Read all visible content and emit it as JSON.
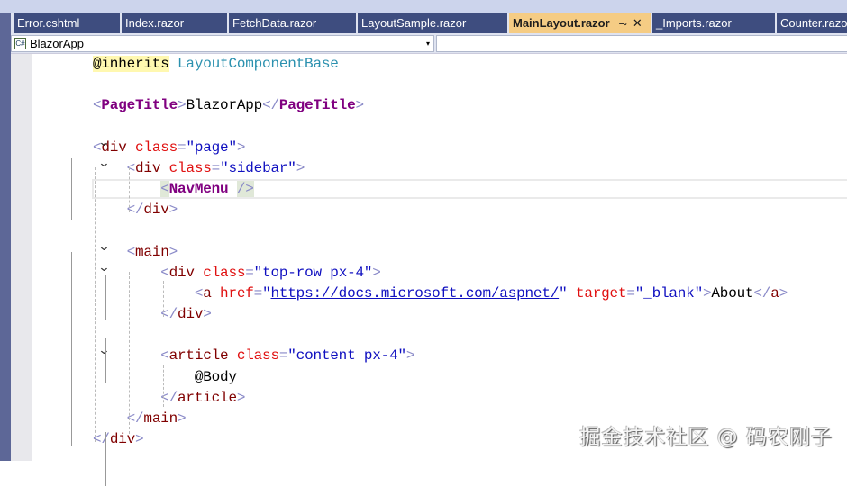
{
  "tabs": [
    {
      "label": "Error.cshtml",
      "active": false
    },
    {
      "label": "Index.razor",
      "active": false
    },
    {
      "label": "FetchData.razor",
      "active": false
    },
    {
      "label": "LayoutSample.razor",
      "active": false
    },
    {
      "label": "MainLayout.razor",
      "active": true,
      "pin": "⊸",
      "close": "✕"
    },
    {
      "label": "_Imports.razor",
      "active": false
    },
    {
      "label": "Counter.razor",
      "active": false
    }
  ],
  "navbar": {
    "project": "BlazorApp",
    "project_icon": "C#",
    "dropdown_arrow": "▾"
  },
  "editor": {
    "lines": [
      [
        {
          "t": "txt",
          "v": "@inherits",
          "c": "dir"
        },
        {
          "t": "txt",
          "v": " "
        },
        {
          "t": "type",
          "v": "LayoutComponentBase"
        }
      ],
      [],
      [
        {
          "t": "br",
          "v": "<"
        },
        {
          "t": "comp",
          "v": "PageTitle"
        },
        {
          "t": "br",
          "v": ">"
        },
        {
          "t": "txt",
          "v": "BlazorApp"
        },
        {
          "t": "br",
          "v": "</"
        },
        {
          "t": "comp",
          "v": "PageTitle"
        },
        {
          "t": "br",
          "v": ">"
        }
      ],
      [],
      [
        {
          "t": "br",
          "v": "<"
        },
        {
          "t": "el",
          "v": "div"
        },
        {
          "t": "txt",
          "v": " "
        },
        {
          "t": "at",
          "v": "class"
        },
        {
          "t": "br",
          "v": "="
        },
        {
          "t": "val",
          "v": "\"page\""
        },
        {
          "t": "br",
          "v": ">"
        }
      ],
      [
        {
          "t": "txt",
          "v": "    "
        },
        {
          "t": "br",
          "v": "<"
        },
        {
          "t": "el",
          "v": "div"
        },
        {
          "t": "txt",
          "v": " "
        },
        {
          "t": "at",
          "v": "class"
        },
        {
          "t": "br",
          "v": "="
        },
        {
          "t": "val",
          "v": "\"sidebar\""
        },
        {
          "t": "br",
          "v": ">"
        }
      ],
      [
        {
          "t": "txt",
          "v": "        "
        },
        {
          "t": "br",
          "v": "<",
          "c": "hl"
        },
        {
          "t": "comp",
          "v": "NavMenu"
        },
        {
          "t": "txt",
          "v": " "
        },
        {
          "t": "br",
          "v": "/>",
          "c": "hl"
        }
      ],
      [
        {
          "t": "txt",
          "v": "    "
        },
        {
          "t": "br",
          "v": "</"
        },
        {
          "t": "el",
          "v": "div"
        },
        {
          "t": "br",
          "v": ">"
        }
      ],
      [],
      [
        {
          "t": "txt",
          "v": "    "
        },
        {
          "t": "br",
          "v": "<"
        },
        {
          "t": "el",
          "v": "main"
        },
        {
          "t": "br",
          "v": ">"
        }
      ],
      [
        {
          "t": "txt",
          "v": "        "
        },
        {
          "t": "br",
          "v": "<"
        },
        {
          "t": "el",
          "v": "div"
        },
        {
          "t": "txt",
          "v": " "
        },
        {
          "t": "at",
          "v": "class"
        },
        {
          "t": "br",
          "v": "="
        },
        {
          "t": "val",
          "v": "\"top-row px-4\""
        },
        {
          "t": "br",
          "v": ">"
        }
      ],
      [
        {
          "t": "txt",
          "v": "            "
        },
        {
          "t": "br",
          "v": "<"
        },
        {
          "t": "el",
          "v": "a"
        },
        {
          "t": "txt",
          "v": " "
        },
        {
          "t": "at",
          "v": "href"
        },
        {
          "t": "br",
          "v": "="
        },
        {
          "t": "val",
          "v": "\""
        },
        {
          "t": "link",
          "v": "https://docs.microsoft.com/aspnet/"
        },
        {
          "t": "val",
          "v": "\""
        },
        {
          "t": "txt",
          "v": " "
        },
        {
          "t": "at",
          "v": "target"
        },
        {
          "t": "br",
          "v": "="
        },
        {
          "t": "val",
          "v": "\"_blank\""
        },
        {
          "t": "br",
          "v": ">"
        },
        {
          "t": "txt",
          "v": "About"
        },
        {
          "t": "br",
          "v": "</"
        },
        {
          "t": "el",
          "v": "a"
        },
        {
          "t": "br",
          "v": ">"
        }
      ],
      [
        {
          "t": "txt",
          "v": "        "
        },
        {
          "t": "br",
          "v": "</"
        },
        {
          "t": "el",
          "v": "div"
        },
        {
          "t": "br",
          "v": ">"
        }
      ],
      [],
      [
        {
          "t": "txt",
          "v": "        "
        },
        {
          "t": "br",
          "v": "<"
        },
        {
          "t": "el",
          "v": "article"
        },
        {
          "t": "txt",
          "v": " "
        },
        {
          "t": "at",
          "v": "class"
        },
        {
          "t": "br",
          "v": "="
        },
        {
          "t": "val",
          "v": "\"content px-4\""
        },
        {
          "t": "br",
          "v": ">"
        }
      ],
      [
        {
          "t": "txt",
          "v": "            "
        },
        {
          "t": "txt",
          "v": "@Body"
        }
      ],
      [
        {
          "t": "txt",
          "v": "        "
        },
        {
          "t": "br",
          "v": "</"
        },
        {
          "t": "el",
          "v": "article"
        },
        {
          "t": "br",
          "v": ">"
        }
      ],
      [
        {
          "t": "txt",
          "v": "    "
        },
        {
          "t": "br",
          "v": "</"
        },
        {
          "t": "el",
          "v": "main"
        },
        {
          "t": "br",
          "v": ">"
        }
      ],
      [
        {
          "t": "br",
          "v": "</"
        },
        {
          "t": "el",
          "v": "div"
        },
        {
          "t": "br",
          "v": ">"
        }
      ]
    ],
    "fold_icon": "⌄"
  },
  "watermark": "掘金技术社区 @ 码农刚子"
}
